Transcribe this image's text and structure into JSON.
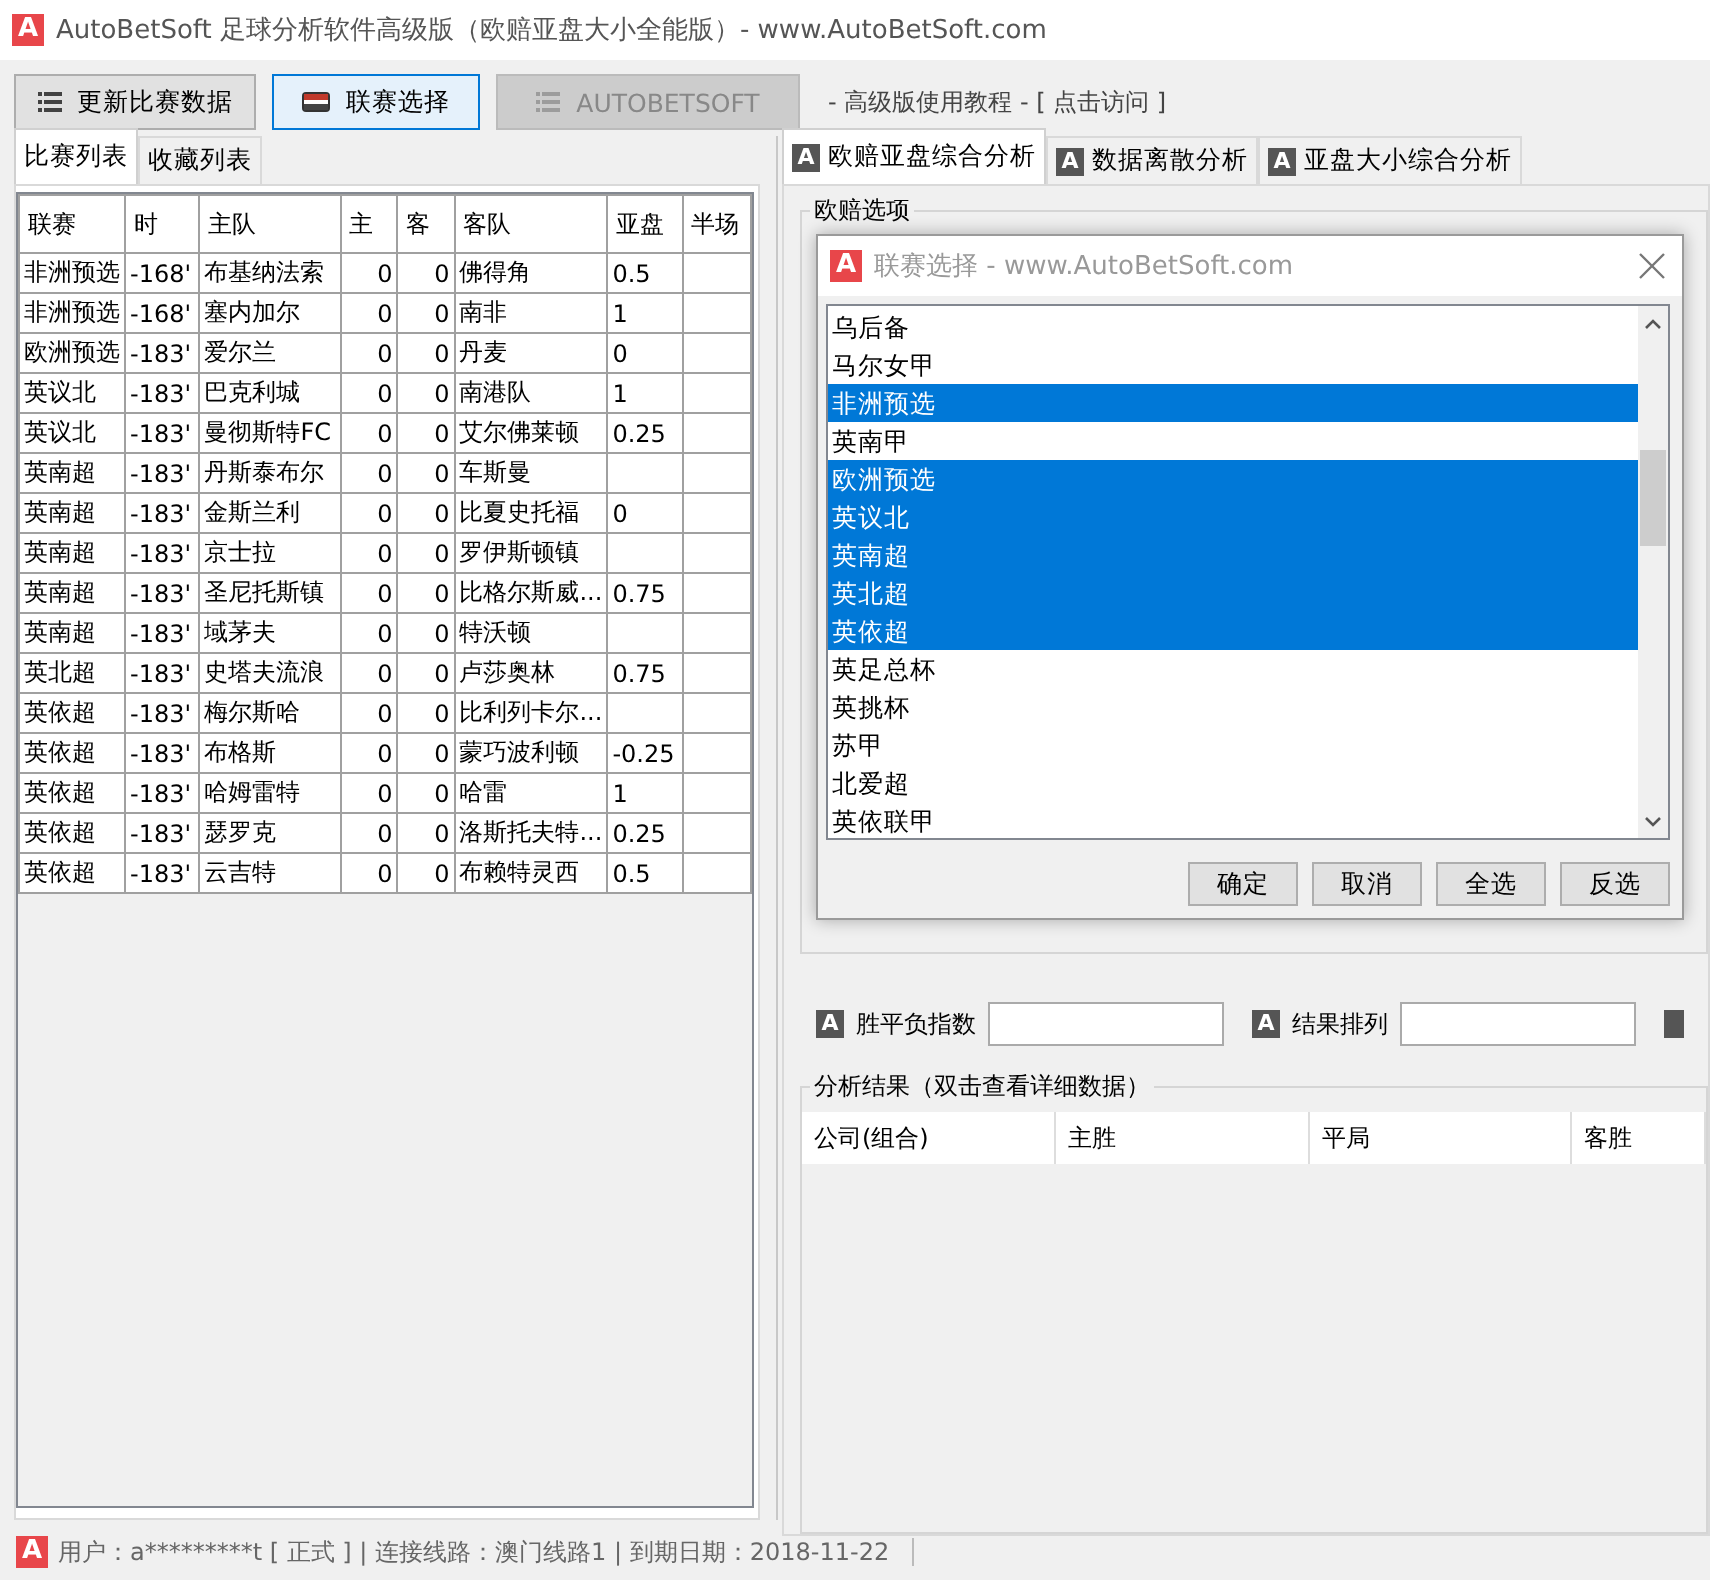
{
  "window": {
    "icon": "A",
    "title": "AutoBetSoft 足球分析软件高级版（欧赔亚盘大小全能版）-  www.AutoBetSoft.com"
  },
  "toolbar": {
    "buttons": [
      {
        "label": "更新比赛数据",
        "kind": "list",
        "disabled": false,
        "selected": false
      },
      {
        "label": "联赛选择",
        "kind": "flag",
        "disabled": false,
        "selected": true
      },
      {
        "label": "AUTOBETSOFT",
        "kind": "list",
        "disabled": true,
        "selected": false
      }
    ],
    "link_text": "-  高级版使用教程 - [ 点击访问 ]"
  },
  "left_tabs": [
    {
      "label": "比赛列表",
      "selected": true
    },
    {
      "label": "收藏列表",
      "selected": false
    }
  ],
  "match_table": {
    "columns": [
      "联赛",
      "时",
      "主队",
      "主",
      "客",
      "客队",
      "亚盘",
      "半场"
    ],
    "rows": [
      [
        "非洲预选",
        "-168'",
        "布基纳法索",
        "0",
        "0",
        "佛得角",
        "0.5",
        ""
      ],
      [
        "非洲预选",
        "-168'",
        "塞内加尔",
        "0",
        "0",
        "南非",
        "1",
        ""
      ],
      [
        "欧洲预选",
        "-183'",
        "爱尔兰",
        "0",
        "0",
        "丹麦",
        "0",
        ""
      ],
      [
        "英议北",
        "-183'",
        "巴克利城",
        "0",
        "0",
        "南港队",
        "1",
        ""
      ],
      [
        "英议北",
        "-183'",
        "曼彻斯特FC",
        "0",
        "0",
        "艾尔佛莱顿",
        "0.25",
        ""
      ],
      [
        "英南超",
        "-183'",
        "丹斯泰布尔",
        "0",
        "0",
        "车斯曼",
        "",
        ""
      ],
      [
        "英南超",
        "-183'",
        "金斯兰利",
        "0",
        "0",
        "比夏史托福",
        "0",
        ""
      ],
      [
        "英南超",
        "-183'",
        "京士拉",
        "0",
        "0",
        "罗伊斯顿镇",
        "",
        ""
      ],
      [
        "英南超",
        "-183'",
        "圣尼托斯镇",
        "0",
        "0",
        "比格尔斯威...",
        "0.75",
        ""
      ],
      [
        "英南超",
        "-183'",
        "域茅夫",
        "0",
        "0",
        "特沃顿",
        "",
        ""
      ],
      [
        "英北超",
        "-183'",
        "史塔夫流浪",
        "0",
        "0",
        "卢莎奥林",
        "0.75",
        ""
      ],
      [
        "英依超",
        "-183'",
        "梅尔斯哈",
        "0",
        "0",
        "比利列卡尔...",
        "",
        ""
      ],
      [
        "英依超",
        "-183'",
        "布格斯",
        "0",
        "0",
        "蒙巧波利顿",
        "-0.25",
        ""
      ],
      [
        "英依超",
        "-183'",
        "哈姆雷特",
        "0",
        "0",
        "哈雷",
        "1",
        ""
      ],
      [
        "英依超",
        "-183'",
        "瑟罗克",
        "0",
        "0",
        "洛斯托夫特...",
        "0.25",
        ""
      ],
      [
        "英依超",
        "-183'",
        "云吉特",
        "0",
        "0",
        "布赖特灵西",
        "0.5",
        ""
      ]
    ]
  },
  "right_tabs": [
    {
      "icon": "A",
      "label": "欧赔亚盘综合分析",
      "selected": true
    },
    {
      "icon": "A",
      "label": "数据离散分析",
      "selected": false
    },
    {
      "icon": "A",
      "label": "亚盘大小综合分析",
      "selected": false
    }
  ],
  "odds_group": {
    "title": "欧赔选项"
  },
  "index_fields": [
    {
      "icon": "A",
      "label": "胜平负指数"
    },
    {
      "icon": "A",
      "label": "结果排列"
    }
  ],
  "result_group": {
    "title": "分析结果（双击查看详细数据）",
    "columns": [
      "公司(组合)",
      "主胜",
      "平局",
      "客胜"
    ]
  },
  "dialog": {
    "icon": "A",
    "title": "联赛选择 - www.AutoBetSoft.com",
    "items": [
      {
        "label": "乌后备",
        "selected": false
      },
      {
        "label": "马尔女甲",
        "selected": false
      },
      {
        "label": "非洲预选",
        "selected": true
      },
      {
        "label": "英南甲",
        "selected": false
      },
      {
        "label": "欧洲预选",
        "selected": true
      },
      {
        "label": "英议北",
        "selected": true
      },
      {
        "label": "英南超",
        "selected": true
      },
      {
        "label": "英北超",
        "selected": true
      },
      {
        "label": "英依超",
        "selected": true
      },
      {
        "label": "英足总杯",
        "selected": false
      },
      {
        "label": "英挑杯",
        "selected": false
      },
      {
        "label": "苏甲",
        "selected": false
      },
      {
        "label": "北爱超",
        "selected": false
      },
      {
        "label": "英依联甲",
        "selected": false
      }
    ],
    "buttons": [
      "确定",
      "取消",
      "全选",
      "反选"
    ]
  },
  "status_bar": {
    "icon": "A",
    "text": "用户：a*********t [ 正式 ] | 连接线路：澳门线路1 | 到期日期：2018-11-22"
  }
}
